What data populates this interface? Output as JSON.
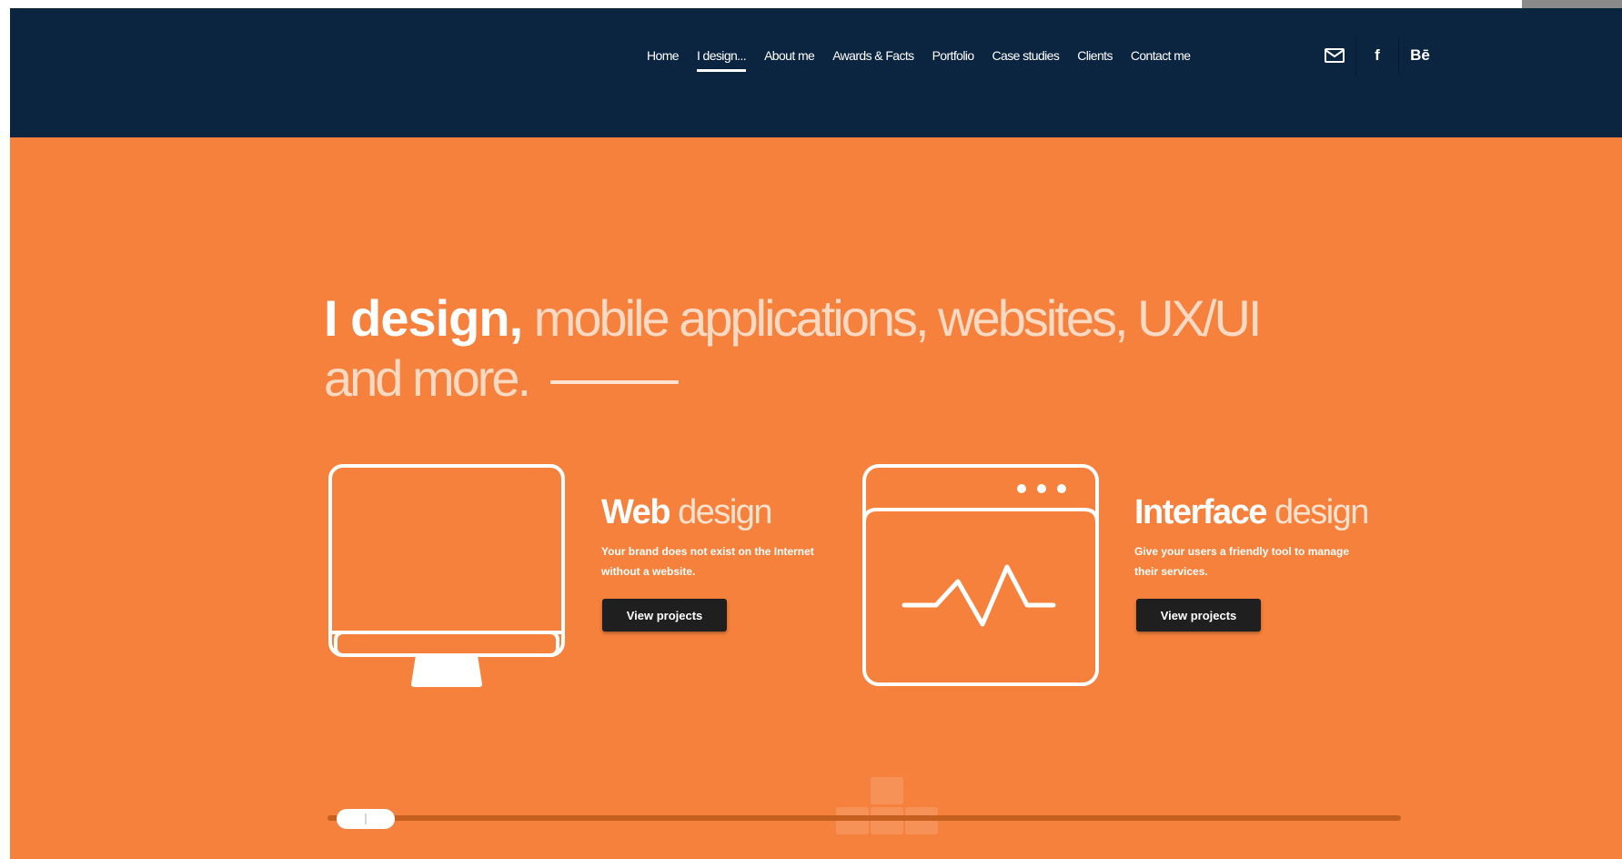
{
  "nav": {
    "items": [
      "Home",
      "I design...",
      "About me",
      "Awards & Facts",
      "Portfolio",
      "Case studies",
      "Clients",
      "Contact me"
    ],
    "active_index": 1
  },
  "social": {
    "mail_icon": "mail-icon",
    "facebook_label": "f",
    "behance_label": "Bē"
  },
  "hero": {
    "strong": "I design,",
    "light_line1": " mobile applications, websites, UX/UI",
    "light_line2": "and more."
  },
  "services": [
    {
      "title_bold": "Web",
      "title_thin": " design",
      "description": "Your brand does not exist on the Internet without a website.",
      "button": "View projects",
      "icon": "monitor-icon"
    },
    {
      "title_bold": "Interface",
      "title_thin": " design",
      "description": "Give your users a friendly tool to manage their services.",
      "button": "View projects",
      "icon": "browser-window-icon"
    }
  ],
  "slider": {
    "position": 0.02
  },
  "colors": {
    "accent": "#f5813c",
    "header": "#0b2440",
    "button": "#1f1f1f"
  }
}
